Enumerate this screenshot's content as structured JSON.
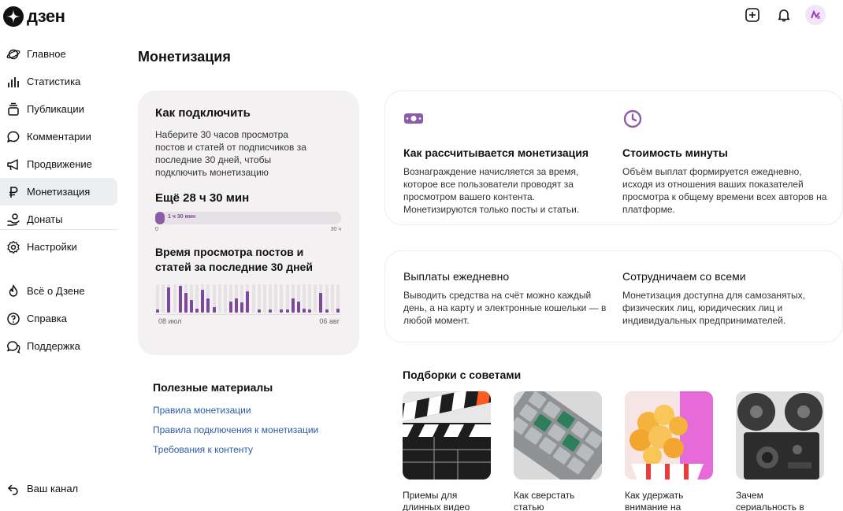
{
  "app": {
    "logo_text": "дзен"
  },
  "colors": {
    "accent": "#8b5ca8",
    "link": "#2c5ba7",
    "card_bg": "#f3f1f1"
  },
  "header": {
    "icons": [
      "add-icon",
      "bell-icon",
      "avatar"
    ]
  },
  "sidebar": {
    "items": [
      {
        "label": "Главное",
        "icon": "planet-icon"
      },
      {
        "label": "Статистика",
        "icon": "stats-icon"
      },
      {
        "label": "Публикации",
        "icon": "publications-icon"
      },
      {
        "label": "Комментарии",
        "icon": "comment-icon"
      },
      {
        "label": "Продвижение",
        "icon": "megaphone-icon"
      },
      {
        "label": "Монетизация",
        "icon": "ruble-icon",
        "active": true
      },
      {
        "label": "Донаты",
        "icon": "donate-icon"
      },
      {
        "label": "Настройки",
        "icon": "gear-icon"
      }
    ],
    "secondary": [
      {
        "label": "Всё о Дзене",
        "icon": "fire-icon"
      },
      {
        "label": "Справка",
        "icon": "help-icon"
      },
      {
        "label": "Поддержка",
        "icon": "support-icon"
      }
    ],
    "bottom": {
      "label": "Ваш канал",
      "icon": "back-icon"
    }
  },
  "main": {
    "title": "Монетизация",
    "connect": {
      "title": "Как подключить",
      "text": "Наберите 30 часов просмотра постов и статей от подписчиков за последние 30 дней, чтобы подключить монетизацию",
      "left": "Ещё 28 ч 30 мин",
      "progress_label": "1 ч 30 мин",
      "progress_fraction": 0.05,
      "scale_start": "0",
      "scale_end": "30 ч",
      "chart_title": "Время просмотра постов и статей за последние 30 дней",
      "axis_start": "08 июл",
      "axis_end": "06 авг"
    },
    "info1": {
      "left": {
        "title": "Как рассчитывается монетизация",
        "text": "Вознаграждение начисляется за время, которое все пользователи проводят за просмотром вашего контента. Монетизируются только посты и статьи.",
        "icon": "money-icon"
      },
      "right": {
        "title": "Стоимость минуты",
        "text": "Объём выплат формируется ежедневно, исходя из отношения ваших показателей просмотра к общему времени всех авторов на платформе.",
        "icon": "clock-icon"
      }
    },
    "info2": {
      "left": {
        "title": "Выплаты ежедневно",
        "text": "Выводить средства на счёт можно каждый день, а на карту и электронные кошельки — в любой момент."
      },
      "right": {
        "title": "Сотрудничаем со всеми",
        "text": "Монетизация доступна для самозанятых, физических лиц, юридических лиц и индивидуальных предпринимателей."
      }
    },
    "useful": {
      "title": "Полезные материалы",
      "links": [
        "Правила монетизации",
        "Правила подключения к монетизации",
        "Требования к контенту"
      ]
    },
    "collections": {
      "title": "Подборки с советами",
      "tiles": [
        {
          "caption": "Приемы для длинных видео",
          "image": "clapperboard"
        },
        {
          "caption": "Как сверстать статью",
          "image": "keyboard"
        },
        {
          "caption": "Как удержать внимание на",
          "image": "popcorn"
        },
        {
          "caption": "Зачем сериальность в",
          "image": "camera"
        }
      ]
    }
  },
  "chart_data": {
    "type": "bar",
    "title": "Время просмотра постов и статей за последние 30 дней",
    "x_start": "08 июл",
    "x_end": "06 авг",
    "values": [
      0.1,
      0,
      0.9,
      0,
      0.95,
      0.7,
      0.45,
      0.15,
      0.8,
      0.5,
      0.2,
      0,
      0,
      0.4,
      0.5,
      0.35,
      0.75,
      0,
      0.1,
      0,
      0.1,
      0,
      0.1,
      0.1,
      0.5,
      0.4,
      0.15,
      0.1,
      0,
      0.7,
      0.1,
      0,
      0.15
    ]
  }
}
